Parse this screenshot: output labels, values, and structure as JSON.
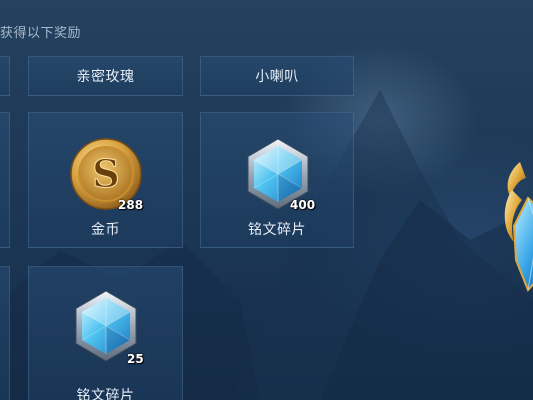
{
  "header": {
    "reward_text": "获得以下奖励"
  },
  "rewards": [
    {
      "label": "亲密玫瑰",
      "count": ""
    },
    {
      "label": "小喇叭",
      "count": ""
    },
    {
      "label": "金币",
      "count": "288",
      "icon": "gold-coin-icon"
    },
    {
      "label": "铭文碎片",
      "count": "400",
      "icon": "inscription-fragment-icon"
    },
    {
      "label": "铭文碎片",
      "count": "25",
      "icon": "inscription-fragment-icon"
    }
  ],
  "colors": {
    "background": "#1e3a58",
    "card_border": "#6e96c3",
    "coin_gold": "#d9a441",
    "crystal_blue": "#4fc3f0"
  }
}
